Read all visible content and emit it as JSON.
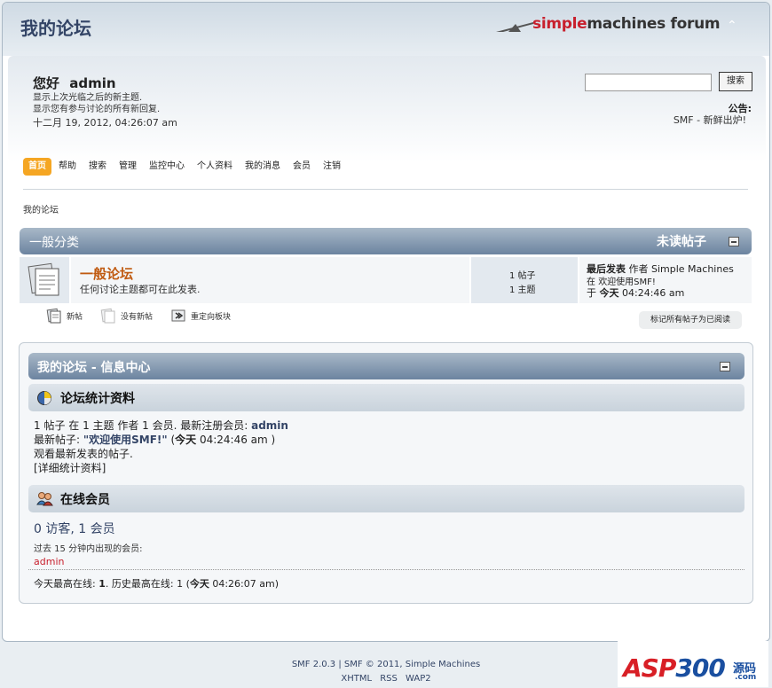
{
  "header": {
    "forum_title": "我的论坛",
    "logo_a": "simple",
    "logo_b": "machines forum",
    "collapse_glyph": "⌃"
  },
  "user": {
    "greeting": "您好",
    "name": "admin",
    "link1": "显示上次光临之后的新主题.",
    "link2": "显示您有参与讨论的所有新回复.",
    "date": "十二月 19, 2012, 04:26:07 am"
  },
  "search": {
    "button": "搜索",
    "value": ""
  },
  "news": {
    "title": "公告:",
    "text": "SMF - 新鲜出炉!"
  },
  "menu": [
    {
      "label": "首页",
      "active": true
    },
    {
      "label": "帮助"
    },
    {
      "label": "搜索"
    },
    {
      "label": "管理"
    },
    {
      "label": "监控中心"
    },
    {
      "label": "个人资料"
    },
    {
      "label": "我的消息"
    },
    {
      "label": "会员"
    },
    {
      "label": "注销"
    }
  ],
  "breadcrumb": "我的论坛",
  "category": {
    "title": "一般分类",
    "unread": "未读帖子",
    "board": {
      "name": "一般论坛",
      "desc": "任何讨论主题都可在此发表.",
      "posts": "1 帖子",
      "topics": "1 主题",
      "last_label": "最后发表",
      "by": "作者",
      "author": "Simple Machines",
      "in": "在",
      "topic": "欢迎使用SMF!",
      "at": "于",
      "today": "今天",
      "time": "04:24:46 am"
    }
  },
  "legend": {
    "new": "新帖",
    "no_new": "没有新帖",
    "redirect": "重定向板块",
    "mark_read": "标记所有帖子为已阅读"
  },
  "info_center": {
    "title": "我的论坛 - 信息中心",
    "stats_title": "论坛统计资料",
    "stats_line1_pre": "1 帖子 在 1 主题 作者 1 会员. 最新注册会员:",
    "stats_line1_user": "admin",
    "stats_line2_pre": "最新帖子:",
    "stats_line2_topic": "\"欢迎使用SMF!\"",
    "stats_line2_open": " (",
    "stats_line2_today": "今天",
    "stats_line2_time": " 04:24:46 am )",
    "stats_line3": "观看最新发表的帖子.",
    "stats_line4": "[详细统计资料]",
    "online_title": "在线会员",
    "online_count": "0 访客, 1 会员",
    "online_recent": "过去 15 分钟内出现的会员:",
    "online_user": "admin",
    "record_pre": "今天最高在线:",
    "record_today_num": "1",
    "record_mid": ". 历史最高在线: 1 (",
    "record_today": "今天",
    "record_time": " 04:26:07 am)"
  },
  "footer": {
    "line1": "SMF 2.0.3 | SMF © 2011, Simple Machines",
    "links": "XHTML RSS WAP2"
  },
  "watermark": {
    "asp": "ASP",
    "num": "300",
    "cn": "源码",
    "dom": ".com"
  },
  "colors": {
    "accent": "#f5a623",
    "header_blue": "#6c84a0",
    "board_link": "#c05a10",
    "user_red": "#c8202d"
  }
}
